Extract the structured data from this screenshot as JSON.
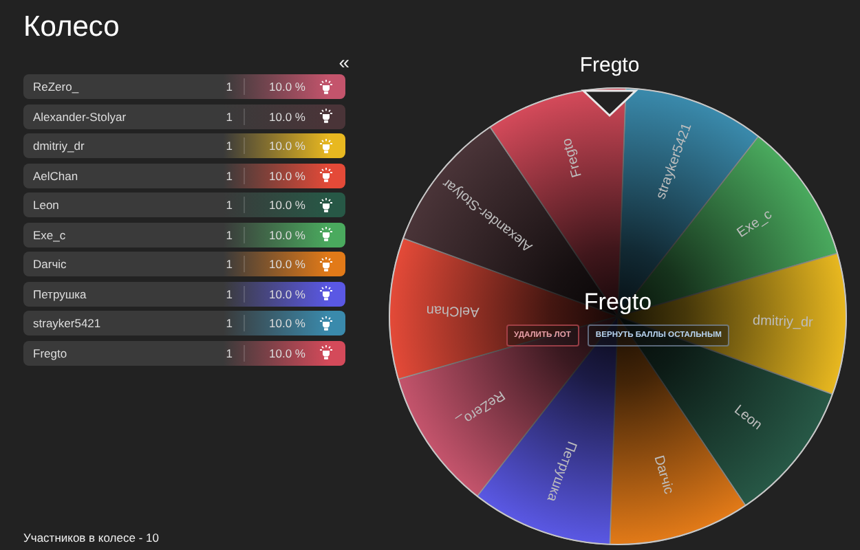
{
  "title": "Колесо",
  "collapse_button": "«",
  "participants": [
    {
      "name": "ReZero_",
      "count": "1",
      "percent": "10.0 %",
      "color": "#c4546c"
    },
    {
      "name": "Alexander-Stolyar",
      "count": "1",
      "percent": "10.0 %",
      "color": "#4a3438"
    },
    {
      "name": "dmitriy_dr",
      "count": "1",
      "percent": "10.0 %",
      "color": "#e8b820"
    },
    {
      "name": "AelChan",
      "count": "1",
      "percent": "10.0 %",
      "color": "#e44a38"
    },
    {
      "name": "Leon",
      "count": "1",
      "percent": "10.0 %",
      "color": "#275846"
    },
    {
      "name": "Exe_c",
      "count": "1",
      "percent": "10.0 %",
      "color": "#4aaa5e"
    },
    {
      "name": "Darчic",
      "count": "1",
      "percent": "10.0 %",
      "color": "#e27a18"
    },
    {
      "name": "Петрушка",
      "count": "1",
      "percent": "10.0 %",
      "color": "#5a58e4"
    },
    {
      "name": "strayker5421",
      "count": "1",
      "percent": "10.0 %",
      "color": "#3a8aac"
    },
    {
      "name": "Fregto",
      "count": "1",
      "percent": "10.0 %",
      "color": "#d44a5a"
    }
  ],
  "footer": "Участников в колесе - 10",
  "wheel": {
    "winner_title": "Fregto",
    "center_label": "Fregto",
    "delete_button": "УДАЛИТЬ ЛОТ",
    "return_button": "ВЕРНУТЬ БАЛЛЫ ОСТАЛЬНЫМ",
    "segments": [
      {
        "label": "strayker5421",
        "color": "#3a8aac"
      },
      {
        "label": "Exe_c",
        "color": "#4aaa5e"
      },
      {
        "label": "dmitriy_dr",
        "color": "#e8b820"
      },
      {
        "label": "Leon",
        "color": "#275846"
      },
      {
        "label": "Darчic",
        "color": "#e27a18"
      },
      {
        "label": "Петрушка",
        "color": "#5a58e4"
      },
      {
        "label": "ReZero_",
        "color": "#c4546c"
      },
      {
        "label": "AelChan",
        "color": "#e44a38"
      },
      {
        "label": "Alexander-Stolyar",
        "color": "#4a3438"
      },
      {
        "label": "Fregto",
        "color": "#d44a5a"
      }
    ]
  }
}
